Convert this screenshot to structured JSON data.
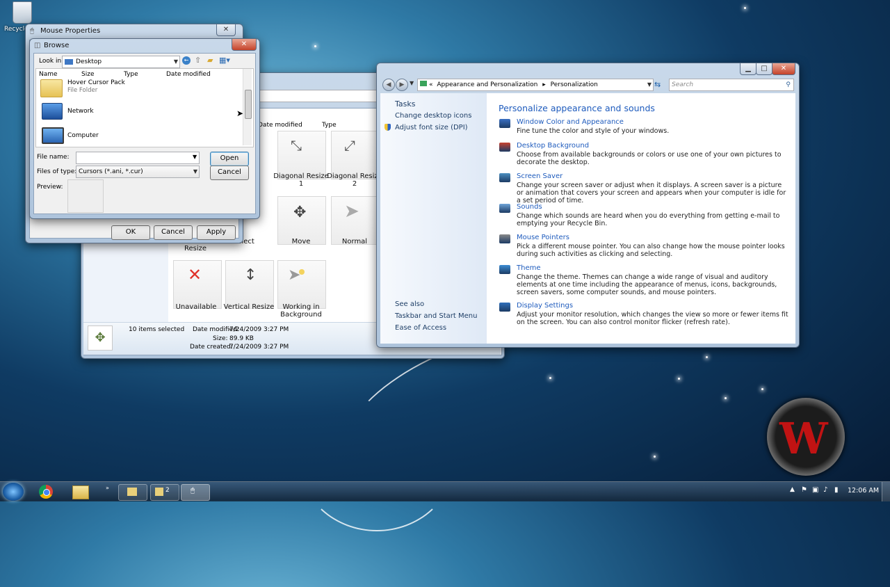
{
  "desktop": {
    "recycle_label": "Recycle"
  },
  "mouse_props": {
    "title": "Mouse Properties",
    "close_glyph": "✕",
    "ok": "OK",
    "cancel": "Cancel",
    "apply": "Apply"
  },
  "browse": {
    "title": "Browse",
    "close_glyph": "✕",
    "look_in_label": "Look in:",
    "look_in_value": "Desktop",
    "columns": [
      "Name",
      "Size",
      "Type",
      "Date modified"
    ],
    "items": [
      {
        "name": "Hover Cursor Pack",
        "sub": "File Folder",
        "icon": "folder-icon"
      },
      {
        "name": "Network",
        "sub": "",
        "icon": "network-icon"
      },
      {
        "name": "Computer",
        "sub": "",
        "icon": "computer-icon"
      }
    ],
    "file_name_label": "File name:",
    "file_name_value": "",
    "file_type_label": "Files of type:",
    "file_type_value": "Cursors (*.ani, *.cur)",
    "preview_label": "Preview:",
    "open": "Open",
    "cancel": "Cancel"
  },
  "explorer": {
    "col_date": "Date modified",
    "col_type": "Type",
    "tiles": [
      {
        "label": "Diagonal Resize 1",
        "icon": "diagonal-resize-1-icon"
      },
      {
        "label": "Diagonal Resize 2",
        "icon": "diagonal-resize-2-icon"
      },
      {
        "label": "Resize",
        "icon": ""
      },
      {
        "label": "k Select",
        "icon": ""
      },
      {
        "label": "Move",
        "icon": "move-icon"
      },
      {
        "label": "Normal",
        "icon": "normal-pointer-icon"
      },
      {
        "label": "Unavailable",
        "icon": "unavailable-icon"
      },
      {
        "label": "Vertical Resize",
        "icon": "vertical-resize-icon"
      },
      {
        "label": "Working in Background",
        "icon": "working-background-icon"
      }
    ],
    "status": {
      "selected": "10 items selected",
      "date_modified_label": "Date modified:",
      "date_modified": "7/24/2009 3:27 PM",
      "size_label": "Size:",
      "size": "89.9 KB",
      "date_created_label": "Date created:",
      "date_created": "7/24/2009 3:27 PM"
    }
  },
  "personalization": {
    "breadcrumb": [
      "Appearance and Personalization",
      "Personalization"
    ],
    "breadcrumb_prefix": "«",
    "search_placeholder": "Search",
    "tasks_title": "Tasks",
    "tasks": [
      "Change desktop icons",
      "Adjust font size (DPI)"
    ],
    "see_also_title": "See also",
    "see_also": [
      "Taskbar and Start Menu",
      "Ease of Access"
    ],
    "heading": "Personalize appearance and sounds",
    "sections": [
      {
        "link": "Window Color and Appearance",
        "desc": "Fine tune the color and style of your windows.",
        "icon": "window-color-icon"
      },
      {
        "link": "Desktop Background",
        "desc": "Choose from available backgrounds or colors or use one of your own pictures to decorate the desktop.",
        "icon": "desktop-background-icon"
      },
      {
        "link": "Screen Saver",
        "desc": "Change your screen saver or adjust when it displays. A screen saver is a picture or animation that covers your screen and appears when your computer is idle for a set period of time.",
        "icon": "screen-saver-icon"
      },
      {
        "link": "Sounds",
        "desc": "Change which sounds are heard when you do everything from getting e-mail to emptying your Recycle Bin.",
        "icon": "sounds-icon"
      },
      {
        "link": "Mouse Pointers",
        "desc": "Pick a different mouse pointer. You can also change how the mouse pointer looks during such activities as clicking and selecting.",
        "icon": "mouse-pointers-icon"
      },
      {
        "link": "Theme",
        "desc": "Change the theme. Themes can change a wide range of visual and auditory elements at one time including the appearance of menus, icons, backgrounds, screen savers, some computer sounds, and mouse pointers.",
        "icon": "theme-icon"
      },
      {
        "link": "Display Settings",
        "desc": "Adjust your monitor resolution, which changes the view so more or fewer items fit on the screen. You can also control monitor flicker (refresh rate).",
        "icon": "display-settings-icon"
      }
    ]
  },
  "taskbar": {
    "group_count": "2",
    "clock": "12:06 AM"
  },
  "colors": {
    "link": "#1e5bbd",
    "heading": "#1e5bbd"
  }
}
